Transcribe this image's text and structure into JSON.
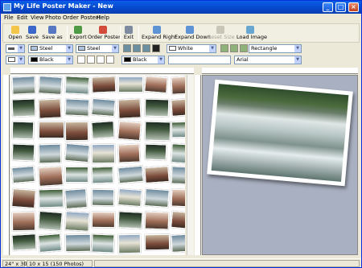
{
  "window": {
    "title": "My Life Poster Maker - New"
  },
  "titlebar_buttons": {
    "minimize": "_",
    "maximize": "□",
    "close": "×"
  },
  "menu": [
    "File",
    "Edit",
    "View",
    "Photo",
    "Order Poster!",
    "Help"
  ],
  "toolbar": {
    "open": "Open",
    "save": "Save",
    "save_as": "Save as",
    "export": "Export",
    "order_poster": "Order Poster",
    "exit": "Exit",
    "expand_right": "Expand Right",
    "expand_down": "Expand Down",
    "reset_size": "Reset Size",
    "load_image": "Load Image"
  },
  "row1": {
    "border_color_1": "Steel",
    "border_color_2": "Steel",
    "background": "White",
    "shape": "Rectangle"
  },
  "row2": {
    "text_color_1": "Black",
    "text_color_2": "Black",
    "text_value": "",
    "font": "Arial"
  },
  "status": {
    "size": "24\" x 30\"",
    "photos": "10 x 15 (150 Photos)"
  },
  "colors": {
    "title_bar": "#0a5fe8",
    "steel": "#b0c4de",
    "black": "#000000",
    "white": "#ffffff"
  }
}
